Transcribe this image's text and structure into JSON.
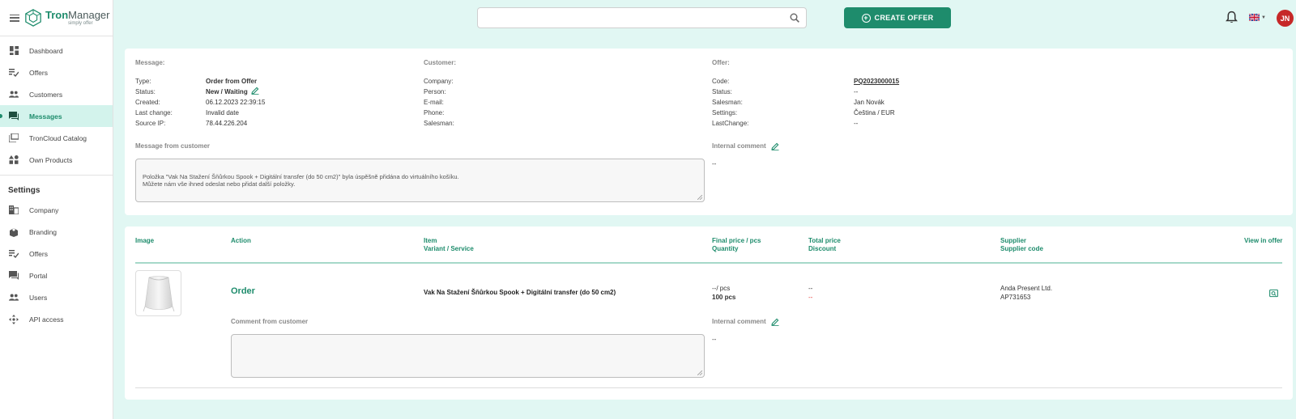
{
  "app": {
    "name_bold": "Tron",
    "name_rest": "Manager",
    "tagline": "simply offer"
  },
  "sidebar": {
    "items": [
      {
        "label": "Dashboard",
        "icon": "dashboard-icon"
      },
      {
        "label": "Offers",
        "icon": "offers-icon"
      },
      {
        "label": "Customers",
        "icon": "customers-icon"
      },
      {
        "label": "Messages",
        "icon": "messages-icon",
        "active": true
      },
      {
        "label": "TronCloud Catalog",
        "icon": "catalog-icon"
      },
      {
        "label": "Own Products",
        "icon": "products-icon"
      }
    ],
    "settings_title": "Settings",
    "settings_items": [
      {
        "label": "Company",
        "icon": "company-icon"
      },
      {
        "label": "Branding",
        "icon": "branding-icon"
      },
      {
        "label": "Offers",
        "icon": "offers-icon"
      },
      {
        "label": "Portal",
        "icon": "portal-icon"
      },
      {
        "label": "Users",
        "icon": "users-icon"
      },
      {
        "label": "API access",
        "icon": "api-icon"
      }
    ]
  },
  "topbar": {
    "search_placeholder": "",
    "create_label": "CREATE OFFER",
    "avatar_initials": "JN"
  },
  "message": {
    "title": "Message:",
    "rows": [
      {
        "k": "Type:",
        "v": "Order from Offer"
      },
      {
        "k": "Status:",
        "v": "New / Waiting"
      },
      {
        "k": "Created:",
        "v": "06.12.2023 22:39:15"
      },
      {
        "k": "Last change:",
        "v": "Invalid date"
      },
      {
        "k": "Source IP:",
        "v": "78.44.226.204"
      }
    ],
    "from_customer_label": "Message from customer",
    "from_customer_text": "Položka \"Vak Na Stažení Šňůrkou Spook + Digitální transfer (do 50 cm2)\" byla úspěšně přidána do virtuálního košíku.\nMůžete nám vše ihned odeslat nebo přidat další položky."
  },
  "customer": {
    "title": "Customer:",
    "rows": [
      {
        "k": "Company:",
        "v": ""
      },
      {
        "k": "Person:",
        "v": ""
      },
      {
        "k": "E-mail:",
        "v": ""
      },
      {
        "k": "Phone:",
        "v": ""
      },
      {
        "k": "Salesman:",
        "v": ""
      }
    ]
  },
  "offer": {
    "title": "Offer:",
    "rows": [
      {
        "k": "Code:",
        "v": "PQ2023000015"
      },
      {
        "k": "Status:",
        "v": "--"
      },
      {
        "k": "Salesman:",
        "v": "Jan Novák"
      },
      {
        "k": "Settings:",
        "v": "Čeština / EUR"
      },
      {
        "k": "LastChange:",
        "v": "--"
      }
    ],
    "internal_comment_label": "Internal comment",
    "internal_comment_value": "--"
  },
  "items": {
    "headers": {
      "image": "Image",
      "action": "Action",
      "item": "Item",
      "variant": "Variant / Service",
      "final_price": "Final price / pcs",
      "quantity": "Quantity",
      "total_price": "Total price",
      "discount": "Discount",
      "supplier": "Supplier",
      "supplier_code": "Supplier code",
      "view": "View in offer"
    },
    "row": {
      "action": "Order",
      "name": "Vak Na Stažení Šňůrkou Spook + Digitální transfer (do 50 cm2)",
      "price": "--/ pcs",
      "quantity": "100 pcs",
      "total": "--",
      "discount": "--",
      "supplier": "Anda Present Ltd.",
      "supplier_code": "AP731653",
      "comment_label": "Comment from customer",
      "internal_comment_label": "Internal comment",
      "internal_comment_value": "--"
    }
  }
}
